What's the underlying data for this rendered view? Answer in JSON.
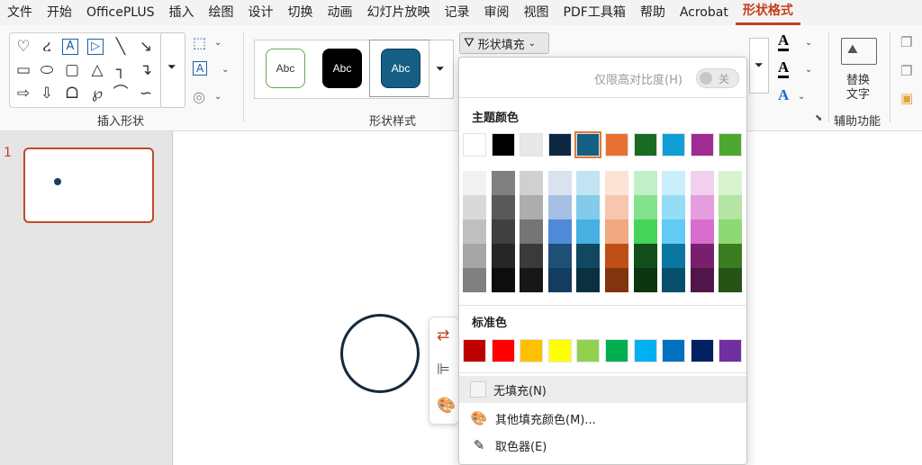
{
  "menu": {
    "tabs": [
      "文件",
      "开始",
      "OfficePLUS",
      "插入",
      "绘图",
      "设计",
      "切换",
      "动画",
      "幻灯片放映",
      "记录",
      "审阅",
      "视图",
      "PDF工具箱",
      "帮助",
      "Acrobat",
      "形状格式"
    ],
    "active": "形状格式"
  },
  "ribbon": {
    "insert_shapes_label": "插入形状",
    "shape_styles_label": "形状样式",
    "styles": [
      {
        "label": "Abc",
        "bg": "#ffffff",
        "fg": "#333333",
        "border": "#6aa84f"
      },
      {
        "label": "Abc",
        "bg": "#000000",
        "fg": "#ffffff",
        "border": "#000000"
      },
      {
        "label": "Abc",
        "bg": "#155e84",
        "fg": "#ffffff",
        "border": "#0d3b55"
      }
    ],
    "fill_button_label": "形状填充",
    "alt_text_label_1": "替换",
    "alt_text_label_2": "文字",
    "accessibility_label": "辅助功能"
  },
  "thumbnails": {
    "slide_number": "1"
  },
  "dropdown": {
    "high_contrast_label": "仅限高对比度(H)",
    "toggle_state": "关",
    "theme_colors_title": "主题颜色",
    "theme_colors": [
      "#ffffff",
      "#000000",
      "#e8e8e8",
      "#0e2841",
      "#156082",
      "#e97132",
      "#196b24",
      "#0f9ed5",
      "#a02b93",
      "#4ea72e"
    ],
    "shades": [
      [
        "#f2f2f2",
        "#d9d9d9",
        "#bfbfbf",
        "#a6a6a6",
        "#808080"
      ],
      [
        "#808080",
        "#595959",
        "#404040",
        "#262626",
        "#0d0d0d"
      ],
      [
        "#d0d0d0",
        "#adadad",
        "#757575",
        "#3a3a3a",
        "#171717"
      ],
      [
        "#dae2ef",
        "#a6c0e5",
        "#4e8ad8",
        "#1f4e79",
        "#153c61"
      ],
      [
        "#c1e4f5",
        "#83cbeb",
        "#45b0e1",
        "#104862",
        "#0a3041"
      ],
      [
        "#fbe3d6",
        "#f6c6ad",
        "#f1a983",
        "#c04f15",
        "#80350e"
      ],
      [
        "#c1f0c8",
        "#83e28e",
        "#47d45b",
        "#124f1b",
        "#0c3512"
      ],
      [
        "#caeefb",
        "#95dcf7",
        "#61cbf3",
        "#0b769f",
        "#074f6a"
      ],
      [
        "#f2cfee",
        "#e59edd",
        "#d86dcd",
        "#78206e",
        "#501549"
      ],
      [
        "#daf2d0",
        "#b4e5a2",
        "#8ed973",
        "#3b7d23",
        "#275317"
      ]
    ],
    "standard_colors_title": "标准色",
    "standard_colors": [
      "#c00000",
      "#ff0000",
      "#ffc000",
      "#ffff00",
      "#92d050",
      "#00b050",
      "#00b0f0",
      "#0070c0",
      "#002060",
      "#7030a0"
    ],
    "no_fill_label": "无填充(N)",
    "more_colors_label": "其他填充颜色(M)...",
    "eyedropper_label": "取色器(E)"
  }
}
